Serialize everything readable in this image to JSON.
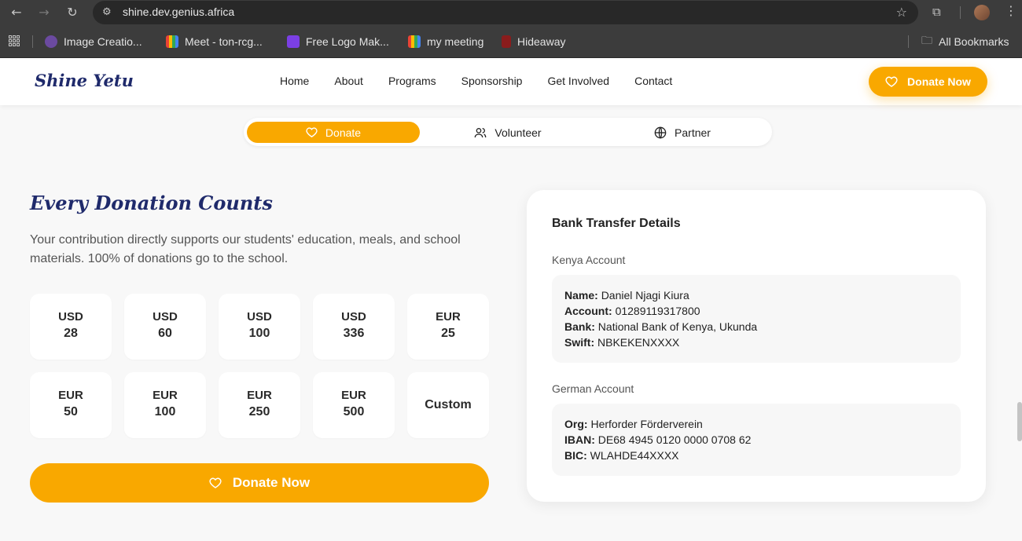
{
  "browser": {
    "url": "shine.dev.genius.africa",
    "bookmarks": [
      {
        "label": "Image Creatio...",
        "color": "#6b4aa0"
      },
      {
        "label": "Meet - ton-rcg...",
        "color": "#34a853"
      },
      {
        "label": "Free Logo Mak...",
        "color": "#7b3fe4"
      },
      {
        "label": "my meeting",
        "color": "#34a853"
      },
      {
        "label": "Hideaway",
        "color": "#8a1c1c"
      }
    ],
    "all_bookmarks": "All Bookmarks"
  },
  "site": {
    "logo": "Shine Yetu",
    "nav": [
      "Home",
      "About",
      "Programs",
      "Sponsorship",
      "Get Involved",
      "Contact"
    ],
    "header_cta": "Donate Now",
    "accent": "#f9a800",
    "brand_navy": "#1f2a6b"
  },
  "tabs": [
    {
      "label": "Donate",
      "icon": "heart-icon",
      "active": true
    },
    {
      "label": "Volunteer",
      "icon": "users-icon",
      "active": false
    },
    {
      "label": "Partner",
      "icon": "globe-icon",
      "active": false
    }
  ],
  "donation": {
    "title": "Every Donation Counts",
    "description": "Your contribution directly supports our students' education, meals, and school materials. 100% of donations go to the school.",
    "amounts": [
      {
        "currency": "USD",
        "value": "28"
      },
      {
        "currency": "USD",
        "value": "60"
      },
      {
        "currency": "USD",
        "value": "100"
      },
      {
        "currency": "USD",
        "value": "336"
      },
      {
        "currency": "EUR",
        "value": "25"
      },
      {
        "currency": "EUR",
        "value": "50"
      },
      {
        "currency": "EUR",
        "value": "100"
      },
      {
        "currency": "EUR",
        "value": "250"
      },
      {
        "currency": "EUR",
        "value": "500"
      }
    ],
    "custom_label": "Custom",
    "cta": "Donate Now"
  },
  "bank": {
    "title": "Bank Transfer Details",
    "kenya": {
      "label": "Kenya Account",
      "name_key": "Name:",
      "name": "Daniel Njagi Kiura",
      "account_key": "Account:",
      "account": "01289119317800",
      "bank_key": "Bank:",
      "bank": "National Bank of Kenya, Ukunda",
      "swift_key": "Swift:",
      "swift": "NBKEKENXXXX"
    },
    "german": {
      "label": "German Account",
      "org_key": "Org:",
      "org": "Herforder Förderverein",
      "iban_key": "IBAN:",
      "iban": "DE68 4945 0120 0000 0708 62",
      "bic_key": "BIC:",
      "bic": "WLAHDE44XXXX"
    }
  }
}
